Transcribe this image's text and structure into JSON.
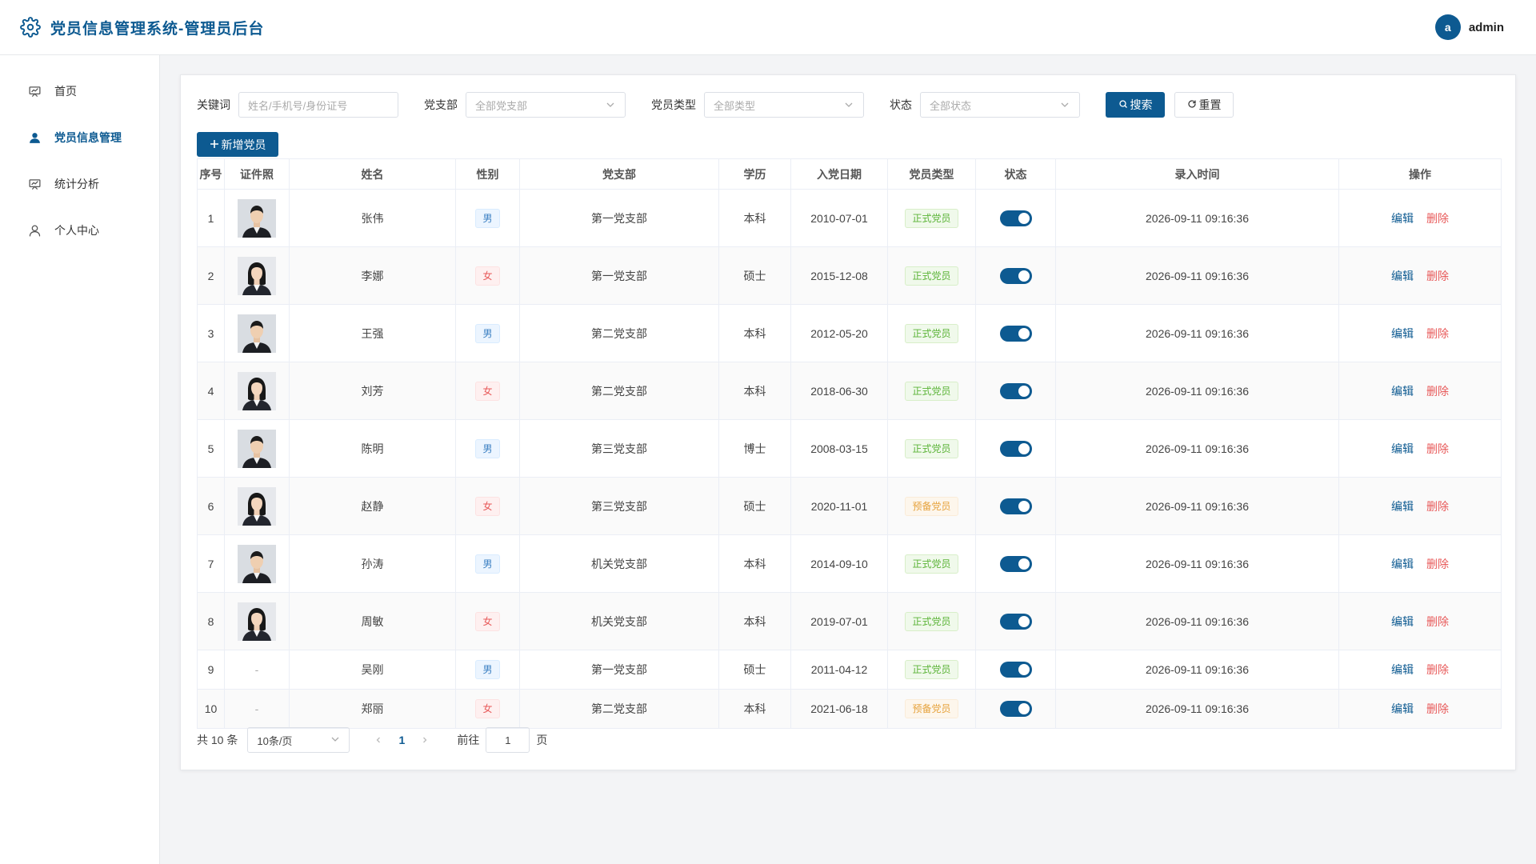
{
  "header": {
    "title": "党员信息管理系统-管理员后台",
    "avatar_letter": "a",
    "username": "admin"
  },
  "sidebar": {
    "items": [
      {
        "label": "首页",
        "icon": "dashboard-board-icon"
      },
      {
        "label": "党员信息管理",
        "icon": "user-solid-icon",
        "active": true
      },
      {
        "label": "统计分析",
        "icon": "stats-board-icon"
      },
      {
        "label": "个人中心",
        "icon": "user-outline-icon"
      }
    ]
  },
  "filters": {
    "keyword_label": "关键词",
    "keyword_placeholder": "姓名/手机号/身份证号",
    "branch_label": "党支部",
    "branch_value": "全部党支部",
    "type_label": "党员类型",
    "type_value": "全部类型",
    "status_label": "状态",
    "status_value": "全部状态",
    "search_label": "搜索",
    "reset_label": "重置"
  },
  "add_button_label": "新增党员",
  "table": {
    "columns": [
      "序号",
      "证件照",
      "姓名",
      "性别",
      "党支部",
      "学历",
      "入党日期",
      "党员类型",
      "状态",
      "录入时间",
      "操作"
    ],
    "edit_label": "编辑",
    "delete_label": "删除",
    "rows": [
      {
        "no": "1",
        "photo": "male",
        "name": "张伟",
        "gender": "男",
        "branch": "第一党支部",
        "edu": "本科",
        "date": "2010-07-01",
        "type": "正式党员",
        "status": "on",
        "time": "2026-09-11 09:16:36"
      },
      {
        "no": "2",
        "photo": "female",
        "name": "李娜",
        "gender": "女",
        "branch": "第一党支部",
        "edu": "硕士",
        "date": "2015-12-08",
        "type": "正式党员",
        "status": "on",
        "time": "2026-09-11 09:16:36"
      },
      {
        "no": "3",
        "photo": "male",
        "name": "王强",
        "gender": "男",
        "branch": "第二党支部",
        "edu": "本科",
        "date": "2012-05-20",
        "type": "正式党员",
        "status": "on",
        "time": "2026-09-11 09:16:36"
      },
      {
        "no": "4",
        "photo": "female",
        "name": "刘芳",
        "gender": "女",
        "branch": "第二党支部",
        "edu": "本科",
        "date": "2018-06-30",
        "type": "正式党员",
        "status": "on",
        "time": "2026-09-11 09:16:36"
      },
      {
        "no": "5",
        "photo": "male",
        "name": "陈明",
        "gender": "男",
        "branch": "第三党支部",
        "edu": "博士",
        "date": "2008-03-15",
        "type": "正式党员",
        "status": "on",
        "time": "2026-09-11 09:16:36"
      },
      {
        "no": "6",
        "photo": "female",
        "name": "赵静",
        "gender": "女",
        "branch": "第三党支部",
        "edu": "硕士",
        "date": "2020-11-01",
        "type": "预备党员",
        "status": "on",
        "time": "2026-09-11 09:16:36"
      },
      {
        "no": "7",
        "photo": "male",
        "name": "孙涛",
        "gender": "男",
        "branch": "机关党支部",
        "edu": "本科",
        "date": "2014-09-10",
        "type": "正式党员",
        "status": "on",
        "time": "2026-09-11 09:16:36"
      },
      {
        "no": "8",
        "photo": "female",
        "name": "周敏",
        "gender": "女",
        "branch": "机关党支部",
        "edu": "本科",
        "date": "2019-07-01",
        "type": "正式党员",
        "status": "on",
        "time": "2026-09-11 09:16:36"
      },
      {
        "no": "9",
        "photo": "-",
        "name": "吴刚",
        "gender": "男",
        "branch": "第一党支部",
        "edu": "硕士",
        "date": "2011-04-12",
        "type": "正式党员",
        "status": "on",
        "time": "2026-09-11 09:16:36"
      },
      {
        "no": "10",
        "photo": "-",
        "name": "郑丽",
        "gender": "女",
        "branch": "第二党支部",
        "edu": "本科",
        "date": "2021-06-18",
        "type": "预备党员",
        "status": "on",
        "time": "2026-09-11 09:16:36"
      }
    ]
  },
  "pagination": {
    "total_label": "共 10 条",
    "page_size": "10条/页",
    "current_page": "1",
    "goto_label": "前往",
    "goto_value": "1",
    "page_unit": "页"
  },
  "colors": {
    "primary": "#0d5a91",
    "danger": "#e85a5a",
    "success": "#5bb437",
    "warning": "#e6a23c"
  }
}
